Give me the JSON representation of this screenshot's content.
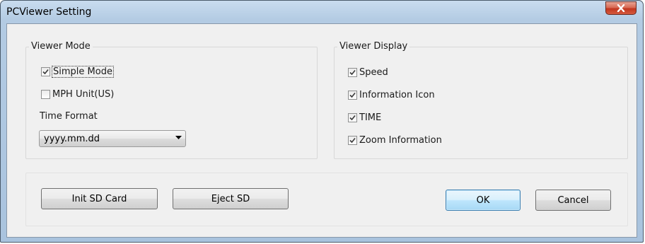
{
  "window": {
    "title": "PCViewer Setting",
    "close_glyph": "x"
  },
  "viewer_mode": {
    "label": "Viewer Mode",
    "items": [
      {
        "label": "Simple Mode",
        "checked": true
      },
      {
        "label": "MPH Unit(US)",
        "checked": false
      }
    ],
    "time_format_label": "Time Format",
    "time_format_value": "yyyy.mm.dd"
  },
  "viewer_display": {
    "label": "Viewer Display",
    "items": [
      {
        "label": "Speed",
        "checked": true
      },
      {
        "label": "Information Icon",
        "checked": true
      },
      {
        "label": "TIME",
        "checked": true
      },
      {
        "label": "Zoom Information",
        "checked": true
      }
    ]
  },
  "buttons": {
    "init_sd": "Init SD Card",
    "eject_sd": "Eject SD",
    "ok": "OK",
    "cancel": "Cancel"
  },
  "colors": {
    "title_bar": "#b3cbe3",
    "close_button": "#c2361f",
    "dialog_bg": "#f0f0f0",
    "default_button": "#bee6fd"
  },
  "icons": {
    "close": "close-icon",
    "check": "checkmark-icon",
    "dropdown": "chevron-down-icon"
  }
}
